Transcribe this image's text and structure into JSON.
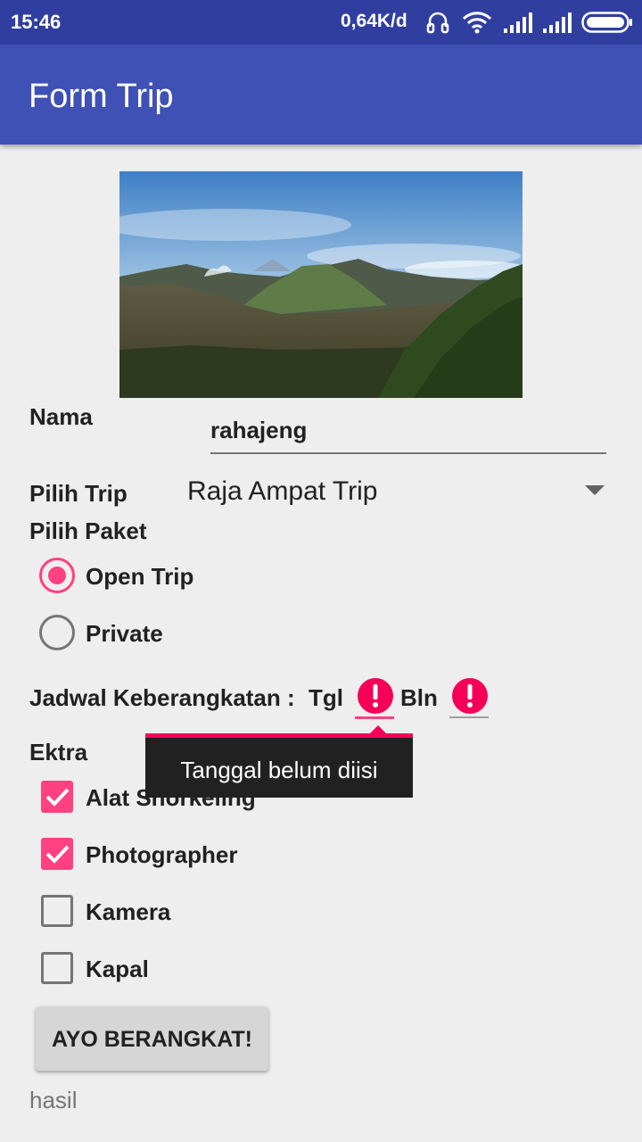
{
  "status_bar": {
    "time": "15:46",
    "speed": "0,64K/d"
  },
  "app_bar": {
    "title": "Form Trip"
  },
  "form": {
    "nama_label": "Nama",
    "nama_value": "rahajeng",
    "pilih_trip_label": "Pilih Trip",
    "pilih_trip_value": "Raja Ampat Trip",
    "pilih_paket_label": "Pilih Paket",
    "paket_options": [
      {
        "label": "Open Trip",
        "selected": true
      },
      {
        "label": "Private",
        "selected": false
      }
    ],
    "jadwal_label": "Jadwal Keberangkatan :",
    "tgl_label": "Tgl",
    "bln_label": "Bln",
    "error_tooltip": "Tanggal belum diisi",
    "ekstra_label": "Ektra",
    "ekstra_options": [
      {
        "label": "Alat Snorkeling",
        "checked": true
      },
      {
        "label": "Photographer",
        "checked": true
      },
      {
        "label": "Kamera",
        "checked": false
      },
      {
        "label": "Kapal",
        "checked": false
      }
    ],
    "submit_label": "AYO BERANGKAT!",
    "result_text": "hasil"
  },
  "colors": {
    "primary": "#3f51b5",
    "primary_dark": "#303f9f",
    "accent": "#ff4081",
    "error": "#f50057"
  }
}
